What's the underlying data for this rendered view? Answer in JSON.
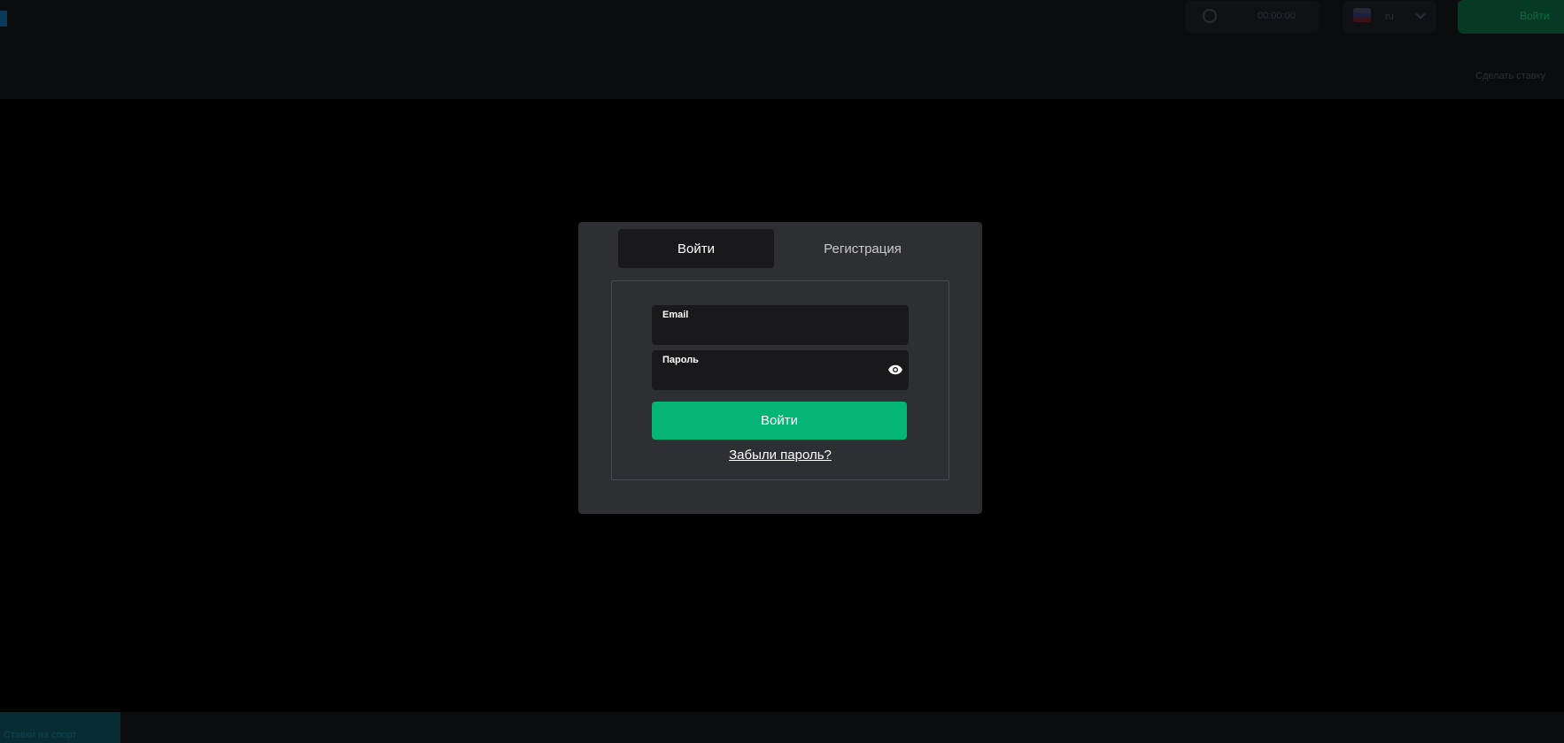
{
  "header": {
    "time_text": "00:00:00",
    "language": "ru",
    "cta_label": "Войти",
    "secondary_text": "Сделать ставку"
  },
  "footer": {
    "chip_text": "Ставки на спорт"
  },
  "auth_modal": {
    "tabs": [
      {
        "label": "Войти",
        "active": true
      },
      {
        "label": "Регистрация",
        "active": false
      }
    ],
    "email": {
      "label": "Email",
      "value": ""
    },
    "password": {
      "label": "Пароль",
      "value": ""
    },
    "submit_label": "Войти",
    "forgot_label": "Забыли пароль?"
  },
  "colors": {
    "accent_green": "#05b576",
    "modal_bg": "#2e2f33",
    "field_bg": "#19191b"
  }
}
